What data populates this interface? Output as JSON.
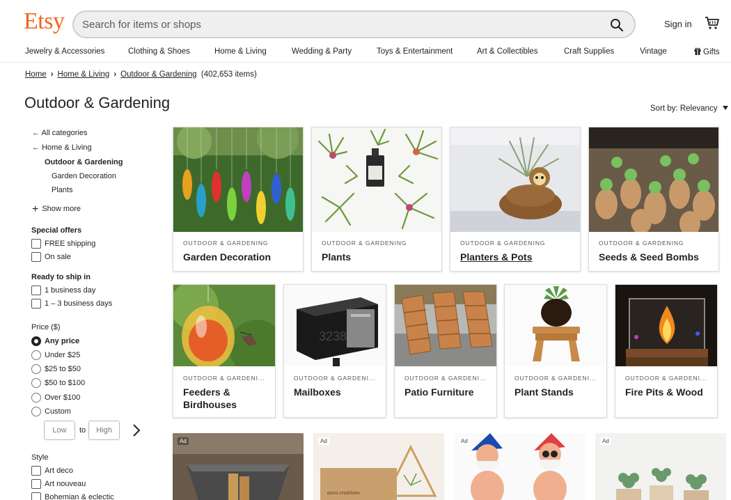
{
  "header": {
    "logo": "Etsy",
    "search_placeholder": "Search for items or shops",
    "sign_in": "Sign in"
  },
  "nav": {
    "items": [
      "Jewelry & Accessories",
      "Clothing & Shoes",
      "Home & Living",
      "Wedding & Party",
      "Toys & Entertainment",
      "Art & Collectibles",
      "Craft Supplies",
      "Vintage",
      "Gifts"
    ]
  },
  "breadcrumb": {
    "home": "Home",
    "home_living": "Home & Living",
    "outdoor": "Outdoor & Gardening",
    "count": "(402,653 items)"
  },
  "page": {
    "title": "Outdoor & Gardening",
    "sort": "Sort by: Relevancy"
  },
  "sidebar": {
    "all_categories": "All categories",
    "home_living": "Home & Living",
    "current": "Outdoor & Gardening",
    "sub": [
      "Garden Decoration",
      "Plants"
    ],
    "show_more": "Show more",
    "special_offers": {
      "heading": "Special offers",
      "options": [
        "FREE shipping",
        "On sale"
      ]
    },
    "ready_to_ship": {
      "heading": "Ready to ship in",
      "options": [
        "1 business day",
        "1 – 3 business days"
      ]
    },
    "price": {
      "heading": "Price ($)",
      "options": [
        "Any price",
        "Under $25",
        "$25 to $50",
        "$50 to $100",
        "Over $100",
        "Custom"
      ],
      "selected": "Any price",
      "low_placeholder": "Low",
      "to": "to",
      "high_placeholder": "High"
    },
    "style": {
      "heading": "Style",
      "options": [
        "Art deco",
        "Art nouveau",
        "Bohemian & eclectic"
      ]
    }
  },
  "row1": [
    {
      "category": "OUTDOOR & GARDENING",
      "name": "Garden Decoration"
    },
    {
      "category": "OUTDOOR & GARDENING",
      "name": "Plants"
    },
    {
      "category": "OUTDOOR & GARDENING",
      "name": "Planters & Pots"
    },
    {
      "category": "OUTDOOR & GARDENING",
      "name": "Seeds & Seed Bombs"
    }
  ],
  "row2": [
    {
      "category": "OUTDOOR & GARDENI...",
      "name": "Feeders & Birdhouses"
    },
    {
      "category": "OUTDOOR & GARDENI...",
      "name": "Mailboxes"
    },
    {
      "category": "OUTDOOR & GARDENI...",
      "name": "Patio Furniture"
    },
    {
      "category": "OUTDOOR & GARDENI...",
      "name": "Plant Stands"
    },
    {
      "category": "OUTDOOR & GARDENI...",
      "name": "Fire Pits & Wood"
    }
  ],
  "ads": {
    "badge": "Ad",
    "mailbox_number": "3238",
    "box_text": "aura creations"
  },
  "colors": {
    "brand": "#f1641e",
    "text": "#222222"
  }
}
